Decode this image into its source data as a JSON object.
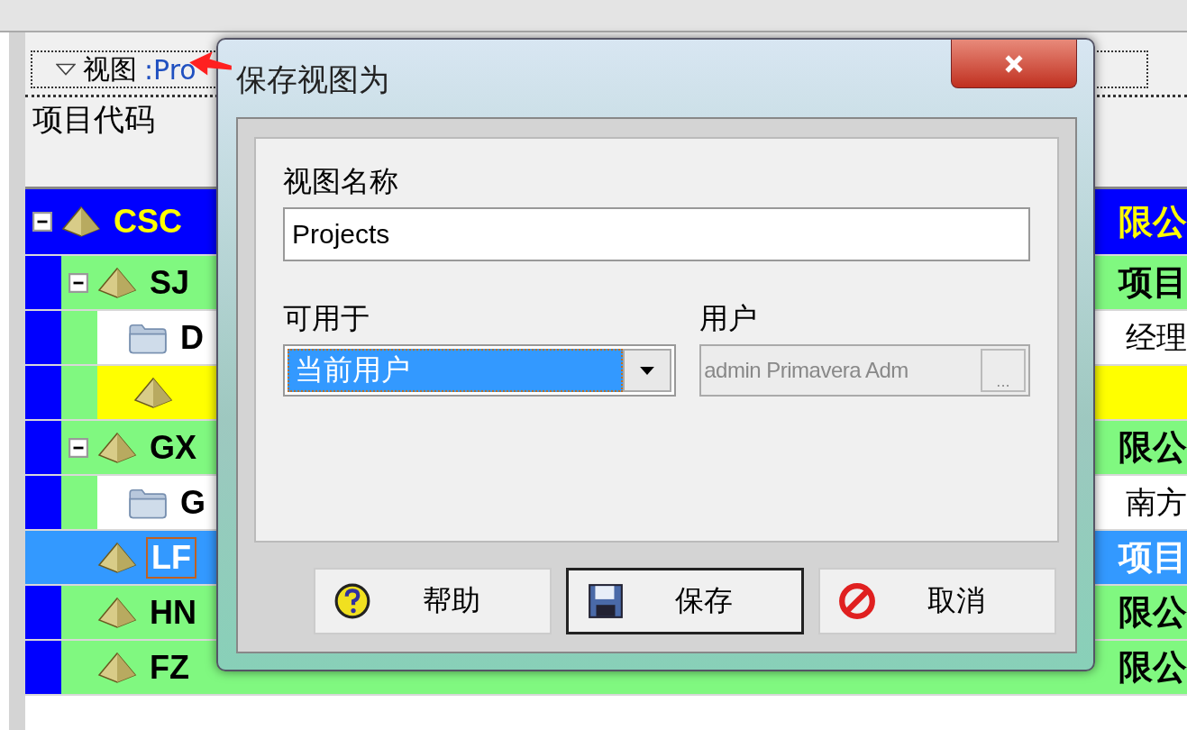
{
  "background": {
    "view_label": "视图",
    "view_name": ":Pro",
    "column_header": "项目代码",
    "rows": [
      {
        "kind": "eps",
        "code": "CSC",
        "right": "限公",
        "selected": false,
        "expanded": true,
        "children": [
          {
            "kind": "eps",
            "code": "SJ",
            "right": "项目",
            "selected": false,
            "expanded": true,
            "children": [
              {
                "kind": "folder",
                "code": "D",
                "right": "经理",
                "selected": false
              },
              {
                "kind": "project",
                "selected": false,
                "highlighted": true
              }
            ]
          },
          {
            "kind": "eps",
            "code": "GX",
            "right": "限公",
            "selected": false,
            "expanded": true,
            "children": [
              {
                "kind": "folder",
                "code": "G",
                "right": "南方",
                "selected": false
              }
            ]
          },
          {
            "kind": "project",
            "code": "LF",
            "right": "项目",
            "selected": true
          },
          {
            "kind": "project",
            "code": "HN",
            "right": "限公",
            "selected": false,
            "highlighted": false
          },
          {
            "kind": "project",
            "code": "FZ",
            "right": "限公",
            "selected": false,
            "highlighted": false
          }
        ]
      }
    ]
  },
  "dialog": {
    "title": "保存视图为",
    "name_label": "视图名称",
    "name_value": "Projects",
    "available_label": "可用于",
    "available_value": "当前用户",
    "user_label": "用户",
    "user_value": "admin Primavera Adm",
    "user_button": "...",
    "buttons": [
      {
        "kind": "help",
        "label": "帮助",
        "default": false
      },
      {
        "kind": "save",
        "label": "保存",
        "default": true
      },
      {
        "kind": "cancel",
        "label": "取消",
        "default": false
      }
    ]
  }
}
